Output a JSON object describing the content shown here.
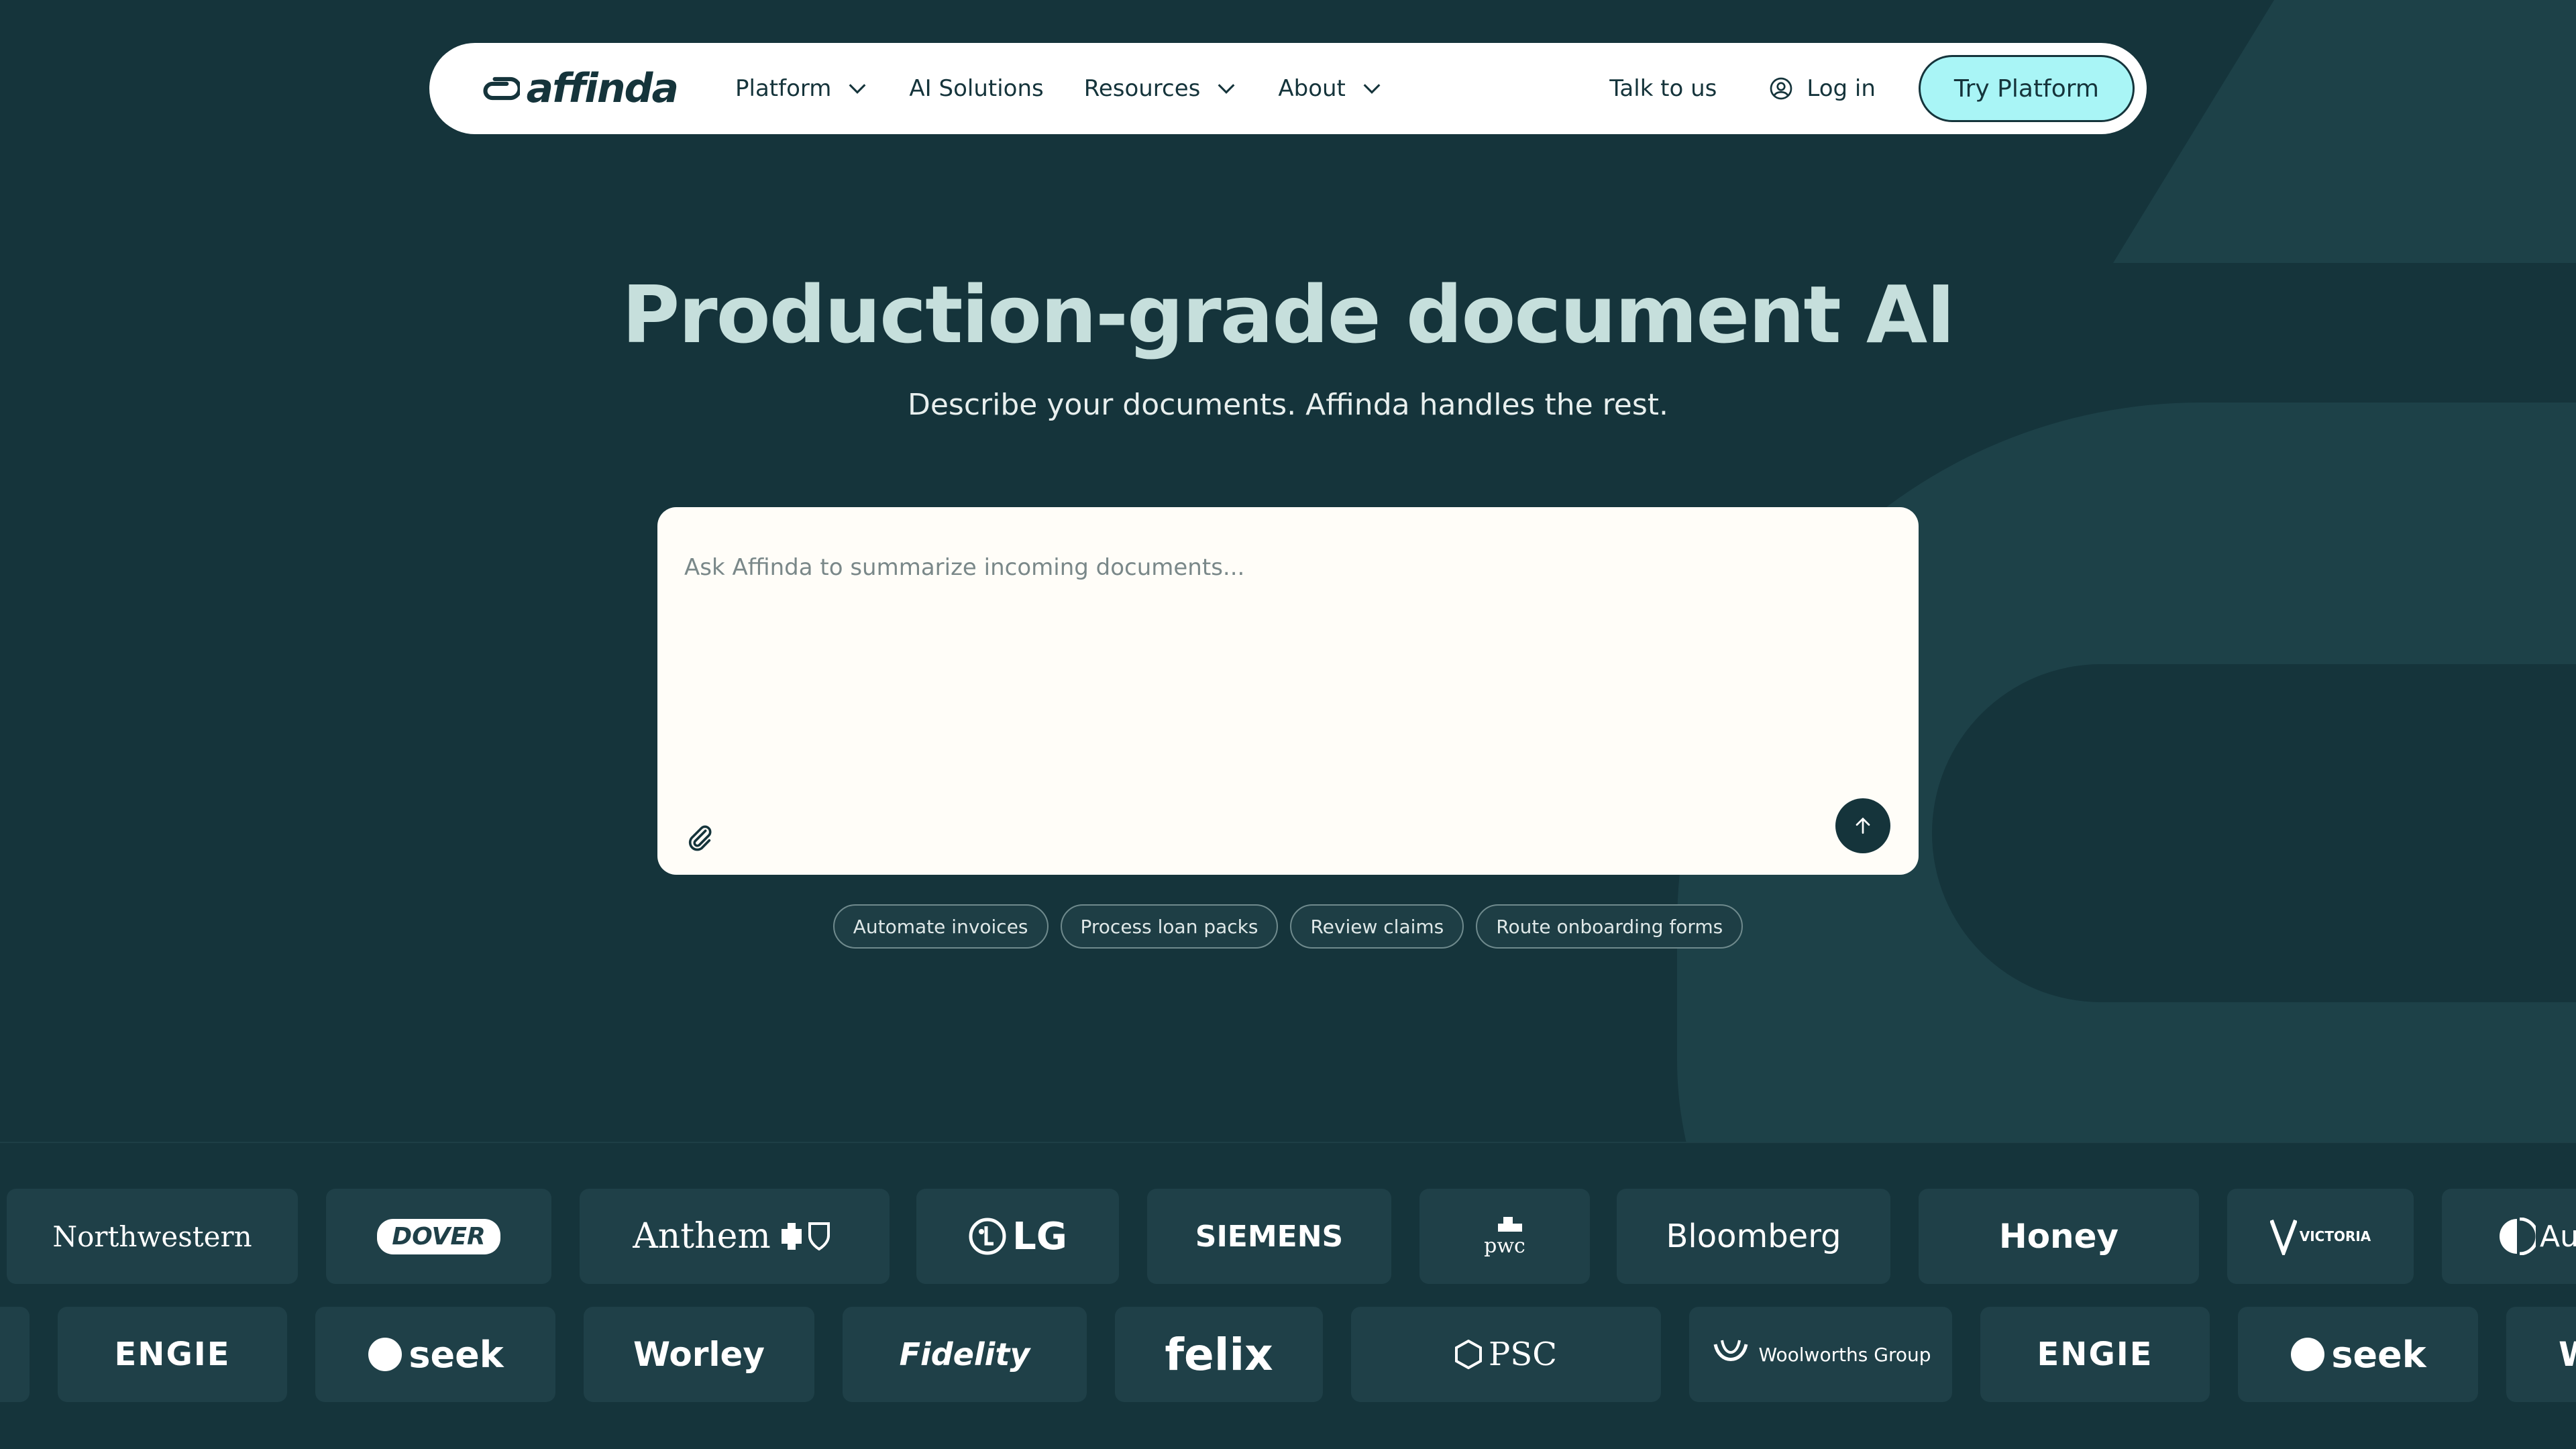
{
  "brand": {
    "name": "affinda"
  },
  "nav": {
    "items": [
      {
        "label": "Platform",
        "dropdown": true
      },
      {
        "label": "AI Solutions",
        "dropdown": false
      },
      {
        "label": "Resources",
        "dropdown": true
      },
      {
        "label": "About",
        "dropdown": true
      }
    ],
    "talk": "Talk to us",
    "login": "Log in",
    "cta": "Try Platform"
  },
  "hero": {
    "title": "Production-grade document AI",
    "subtitle": "Describe your documents. Affinda handles the rest."
  },
  "prompt": {
    "placeholder": "Ask Affinda to summarize incoming documents...",
    "value": ""
  },
  "chips": [
    "Automate invoices",
    "Process loan packs",
    "Review claims",
    "Route onboarding forms"
  ],
  "logos_row1": [
    "Northwestern",
    "DOVER",
    "Anthem",
    "LG",
    "SIEMENS",
    "pwc",
    "Bloomberg",
    "Honey",
    "VICTORIA",
    "Aus"
  ],
  "logos_row2": [
    "ENGIE",
    "seek",
    "Worley",
    "Fidelity",
    "felix",
    "PSC",
    "Woolworths Group",
    "ENGIE",
    "seek",
    "W"
  ],
  "colors": {
    "background": "#15343b",
    "accent": "#a9f5f6",
    "card": "#fffdf8"
  }
}
